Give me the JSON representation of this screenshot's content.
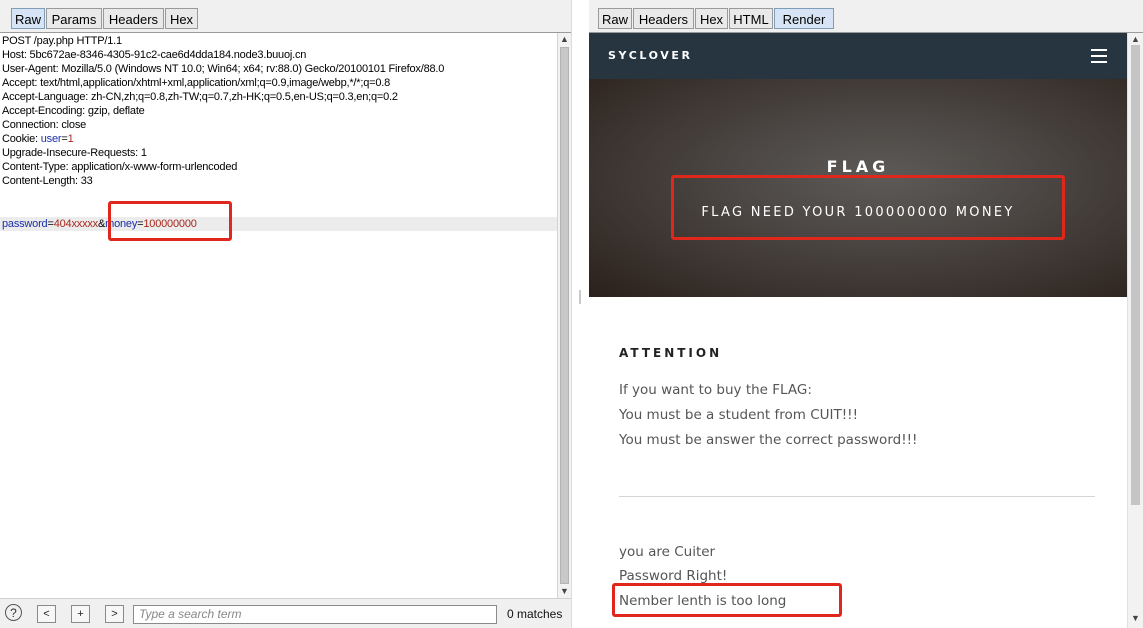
{
  "left": {
    "tabs": [
      {
        "label": "Raw",
        "active": true
      },
      {
        "label": "Params",
        "active": false
      },
      {
        "label": "Headers",
        "active": false
      },
      {
        "label": "Hex",
        "active": false
      }
    ],
    "request": {
      "lines": [
        "POST /pay.php HTTP/1.1",
        "Host: 5bc672ae-8346-4305-91c2-cae6d4dda184.node3.buuoj.cn",
        "User-Agent: Mozilla/5.0 (Windows NT 10.0; Win64; x64; rv:88.0) Gecko/20100101 Firefox/88.0",
        "Accept: text/html,application/xhtml+xml,application/xml;q=0.9,image/webp,*/*;q=0.8",
        "Accept-Language: zh-CN,zh;q=0.8,zh-TW;q=0.7,zh-HK;q=0.5,en-US;q=0.3,en;q=0.2",
        "Accept-Encoding: gzip, deflate",
        "Connection: close"
      ],
      "cookie_prefix": "Cookie: ",
      "cookie_name": "user",
      "cookie_eq": "=",
      "cookie_value": "1",
      "lines_after": [
        "Upgrade-Insecure-Requests: 1",
        "Content-Type: application/x-www-form-urlencoded",
        "Content-Length: 33"
      ],
      "body": {
        "param1_name": "password",
        "eq1": "=",
        "param1_value": "404xxxxx",
        "amp": "&",
        "param2_name": "money",
        "eq2": "=",
        "param2_value": "100000000"
      }
    },
    "bottom": {
      "help_icon": "?",
      "prev_label": "<",
      "add_label": "+",
      "next_label": ">",
      "search_placeholder": "Type a search term",
      "match_count": "0 matches"
    }
  },
  "right": {
    "tabs": [
      {
        "label": "Raw",
        "active": false
      },
      {
        "label": "Headers",
        "active": false
      },
      {
        "label": "Hex",
        "active": false
      },
      {
        "label": "HTML",
        "active": false
      },
      {
        "label": "Render",
        "active": true
      }
    ],
    "page": {
      "brand": "SYCLOVER",
      "menu_icon": "hamburger-menu-icon",
      "hero_title": "FLAG",
      "hero_subtitle": "FLAG NEED YOUR 100000000 MONEY",
      "attention_title": "ATTENTION",
      "attention_lines": [
        "If you want to buy the FLAG:",
        "You must be a student from CUIT!!!",
        "You must be answer the correct password!!!"
      ],
      "result_lines": [
        "you are Cuiter",
        "Password Right!",
        "Nember lenth is too long"
      ]
    }
  },
  "colors": {
    "highlight_box": "#e0271c",
    "nav_bg": "#263540",
    "param_name": "#1a2ea8",
    "param_value": "#a6281f"
  }
}
